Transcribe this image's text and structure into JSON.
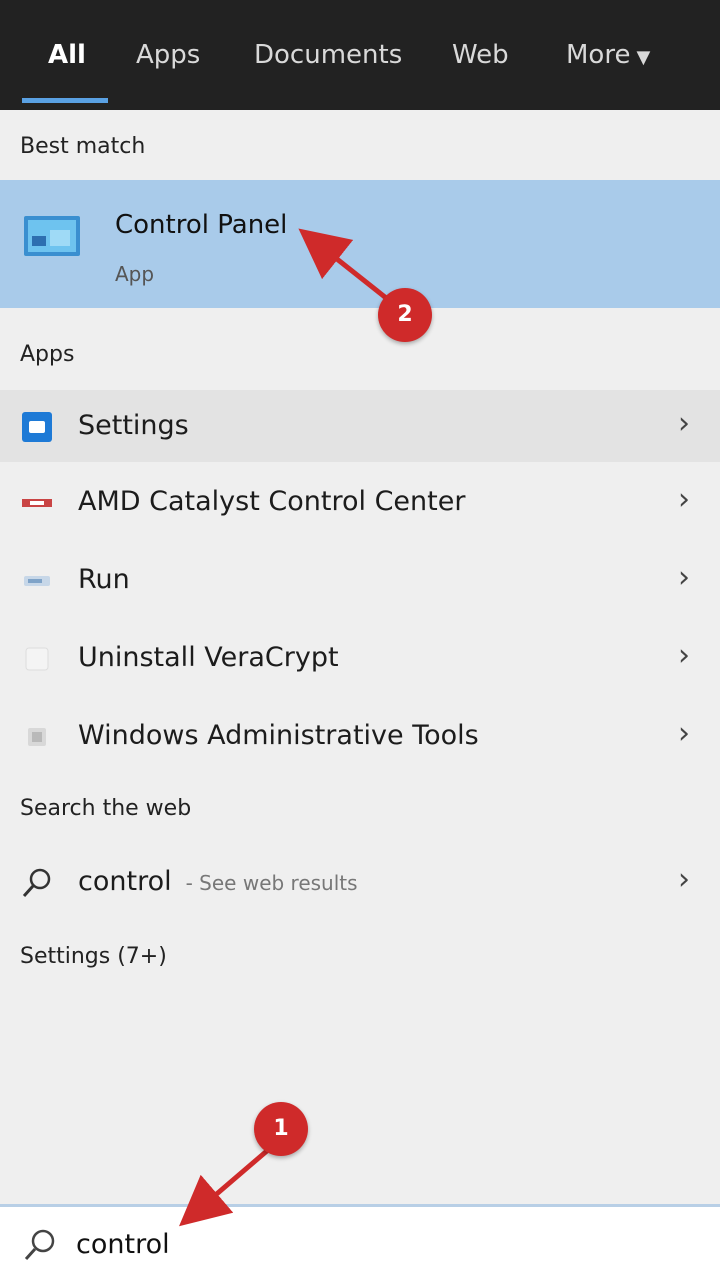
{
  "tabs": [
    {
      "label": "All"
    },
    {
      "label": "Apps"
    },
    {
      "label": "Documents"
    },
    {
      "label": "Web"
    },
    {
      "label": "More"
    }
  ],
  "best_match": {
    "section_title": "Best match",
    "title": "Control Panel",
    "subtitle": "App"
  },
  "apps": {
    "section_title": "Apps",
    "items": [
      {
        "label": "Settings",
        "icon": "settings-icon"
      },
      {
        "label": "AMD Catalyst Control Center",
        "icon": "amd-icon"
      },
      {
        "label": "Run",
        "icon": "run-icon"
      },
      {
        "label": "Uninstall VeraCrypt",
        "icon": "veracrypt-icon"
      },
      {
        "label": "Windows Administrative Tools",
        "icon": "admin-tools-icon"
      }
    ]
  },
  "web": {
    "section_title": "Search the web",
    "query": "control",
    "hint": "- See web results"
  },
  "settings_section": {
    "title": "Settings (7+)"
  },
  "search": {
    "query": "control"
  },
  "annotations": {
    "step1": "1",
    "step2": "2",
    "color": "#cf2a2a"
  }
}
